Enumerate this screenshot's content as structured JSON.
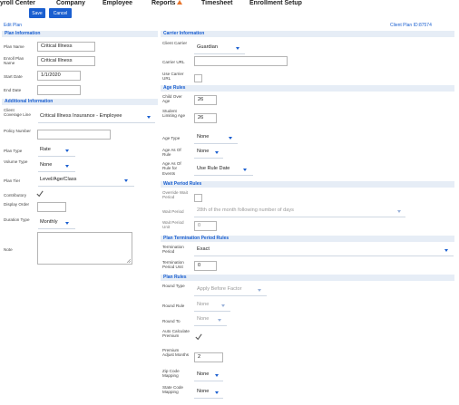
{
  "nav": {
    "items": [
      "yroll Center",
      "Company",
      "Employee",
      "Reports",
      "Timesheet",
      "Enrollment Setup"
    ]
  },
  "buttons": {
    "save": "Save",
    "cancel": "Cancel"
  },
  "page": {
    "title": "Edit Plan",
    "client_plan_id": "Client Plan ID:87574"
  },
  "plan_information": {
    "header": "Plan Information",
    "plan_name_label": "Plan Name",
    "plan_name": "Critical Illness",
    "enroll_plan_name_label": "Enroll Plan Name",
    "enroll_plan_name": "Critical Illness",
    "start_date_label": "Start Date",
    "start_date": "1/1/2020",
    "end_date_label": "End Date",
    "end_date": ""
  },
  "additional_information": {
    "header": "Additional Information",
    "client_coverage_line_label": "Client Coverage Line",
    "client_coverage_line": "Critical Illness Insurance - Employee",
    "policy_number_label": "Policy Number",
    "policy_number": "",
    "plan_type_label": "Plan Type",
    "plan_type": "Rate",
    "volume_type_label": "Volume Type",
    "volume_type": "None",
    "plan_tier_label": "Plan Tier",
    "plan_tier": "Level/Age/Class",
    "contributory_label": "Contributory",
    "contributory": true,
    "display_order_label": "Display Order",
    "display_order": "",
    "duration_type_label": "Duration Type",
    "duration_type": "Monthly",
    "note_label": "Note",
    "note": ""
  },
  "carrier_information": {
    "header": "Carrier Information",
    "client_carrier_label": "Client Carrier",
    "client_carrier": "Guardian",
    "carrier_url_label": "Carrier URL",
    "carrier_url": "",
    "use_carrier_url_label": "Use Carrier URL",
    "use_carrier_url": false
  },
  "age_rules": {
    "header": "Age Rules",
    "child_over_age_label": "Child Over Age",
    "child_over_age": "26",
    "student_limiting_age_label": "Student Limiting Age",
    "student_limiting_age": "26",
    "age_type_label": "Age Type",
    "age_type": "None",
    "age_as_of_rule_label": "Age As Of Rule",
    "age_as_of_rule": "None",
    "age_as_of_rule_events_label": "Age As Of Rule for Events",
    "age_as_of_rule_events": "Use Rule Date"
  },
  "wait_period_rules": {
    "header": "Wait Period Rules",
    "override_label": "Override Wait Period",
    "override": false,
    "wait_period_label": "Wait Period",
    "wait_period": "28th of the month following number of days",
    "wait_period_unit_label": "Wait Period Unit",
    "wait_period_unit": "0"
  },
  "plan_termination_rules": {
    "header": "Plan Termination Period Rules",
    "termination_period_label": "Termination Period",
    "termination_period": "Exact",
    "termination_period_unit_label": "Termination Period Unit",
    "termination_period_unit": "0"
  },
  "plan_rules": {
    "header": "Plan Rules",
    "round_type_label": "Round Type",
    "round_type": "Apply Before Factor",
    "round_rule_label": "Round Rule",
    "round_rule": "None",
    "round_to_label": "Round To",
    "round_to": "None",
    "auto_calculate_label": "Auto Calculate Premium",
    "auto_calculate": true,
    "premium_adjust_label": "Premium Adjust Months",
    "premium_adjust": "2",
    "zip_code_mapping_label": "Zip Code Mapping",
    "zip_code_mapping": "None",
    "state_code_mapping_label": "State Code Mapping",
    "state_code_mapping": "None"
  },
  "colors": {
    "accent": "#1a5fd0",
    "section_bg": "#e6edf6",
    "warning": "#e8742a"
  }
}
